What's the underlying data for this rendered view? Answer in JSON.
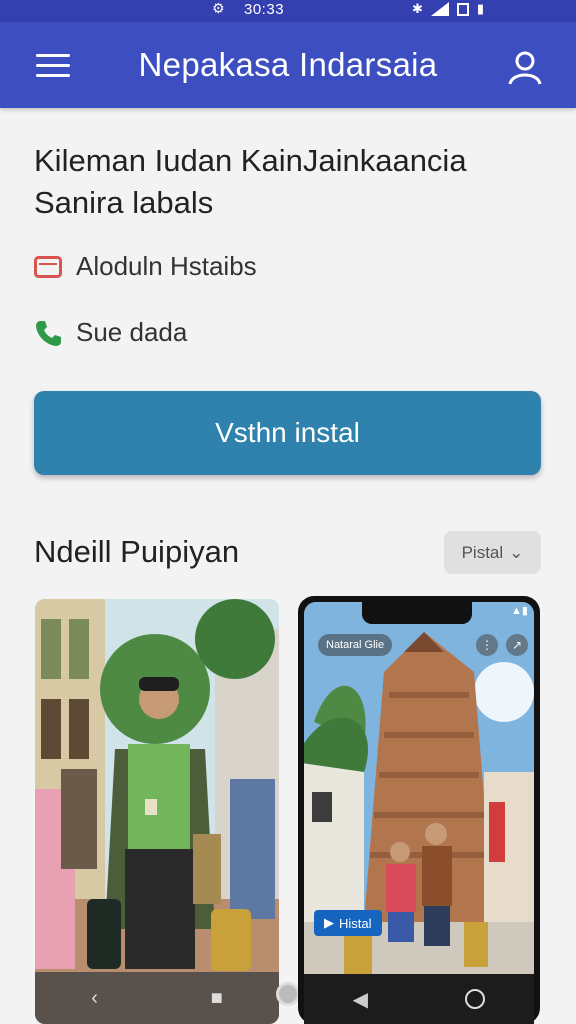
{
  "status_bar": {
    "time": "30:33"
  },
  "app_bar": {
    "title": "Nepakasa Indarsaia"
  },
  "headline": {
    "line1": "Kileman Iudan KainJainkaancia",
    "line2": "Sanira labals"
  },
  "info": {
    "row1_text": "Aloduln Hstaibs",
    "row2_text": "Sue dada"
  },
  "primary_button": {
    "label": "Vsthn instal"
  },
  "section": {
    "title": "Ndeill Puipiyan",
    "filter_label": "Pistal"
  },
  "preview": {
    "pill_text": "Nataral Glie",
    "install_label": "Histal"
  },
  "colors": {
    "status_bar": "#3540b0",
    "app_bar": "#3d4fc0",
    "primary_button": "#2f82ad",
    "mail_icon": "#d9534f",
    "phone_icon": "#2e9a4a"
  },
  "icons": {
    "menu": "hamburger-icon",
    "account": "person-icon",
    "mail": "envelope-icon",
    "phone": "phone-icon",
    "filter": "chevron-down-icon"
  }
}
